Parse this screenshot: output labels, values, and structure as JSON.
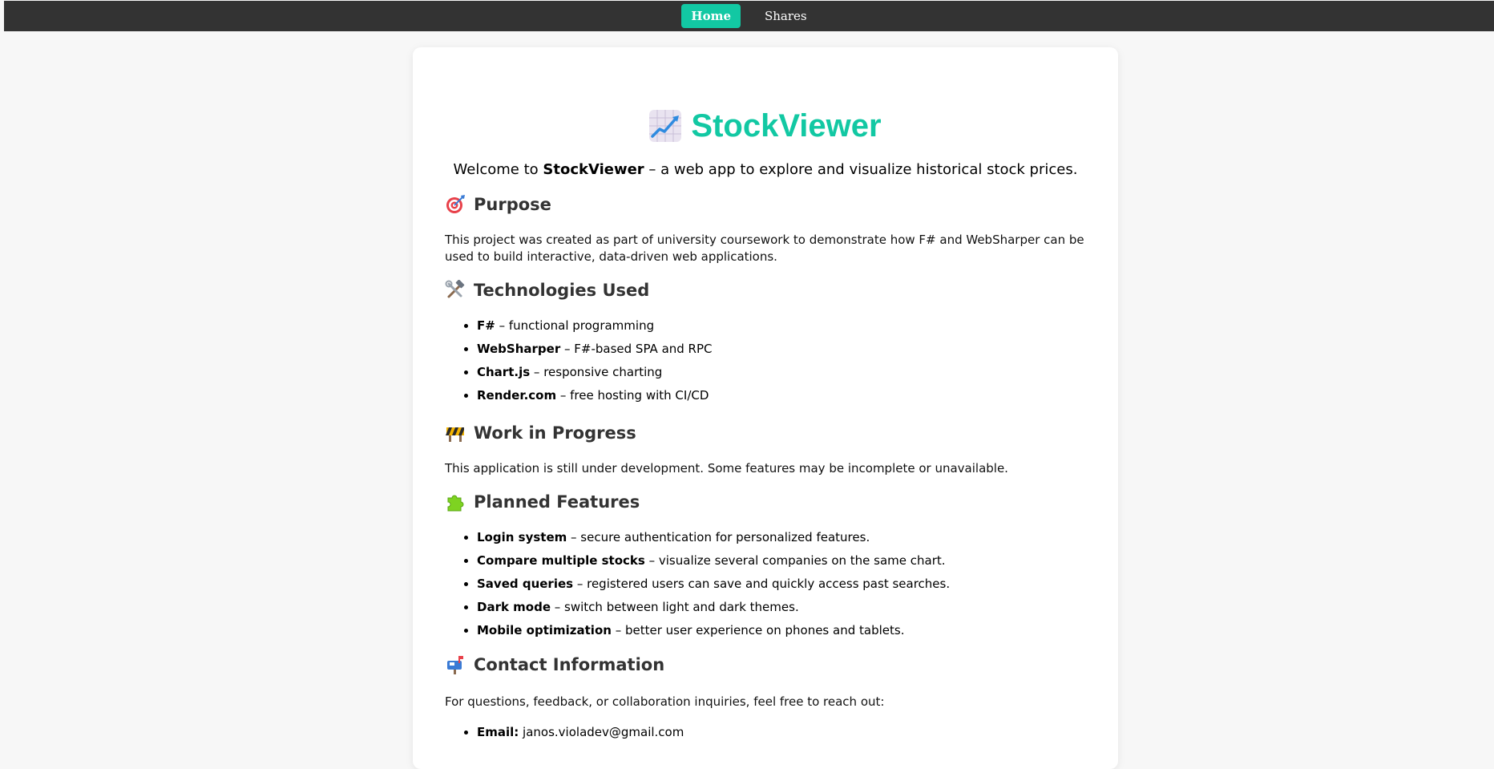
{
  "nav": {
    "items": [
      {
        "label": "Home",
        "active": true
      },
      {
        "label": "Shares",
        "active": false
      }
    ]
  },
  "header": {
    "icon": "chart-increasing-icon",
    "title": "StockViewer",
    "welcome_pre": "Welcome to ",
    "welcome_bold": "StockViewer",
    "welcome_post": " – a web app to explore and visualize historical stock prices."
  },
  "sections": {
    "purpose": {
      "icon": "direct-hit-icon",
      "title": "Purpose",
      "text": "This project was created as part of university coursework to demonstrate how F# and WebSharper can be used to build interactive, data-driven web applications."
    },
    "tech": {
      "icon": "hammer-wrench-icon",
      "title": "Technologies Used",
      "items": [
        {
          "name": "F#",
          "desc": " – functional programming"
        },
        {
          "name": "WebSharper",
          "desc": " – F#-based SPA and RPC"
        },
        {
          "name": "Chart.js",
          "desc": " – responsive charting"
        },
        {
          "name": "Render.com",
          "desc": " – free hosting with CI/CD"
        }
      ]
    },
    "wip": {
      "icon": "construction-icon",
      "title": "Work in Progress",
      "text": "This application is still under development. Some features may be incomplete or unavailable."
    },
    "planned": {
      "icon": "puzzle-piece-icon",
      "title": "Planned Features",
      "items": [
        {
          "name": "Login system",
          "desc": " – secure authentication for personalized features."
        },
        {
          "name": "Compare multiple stocks",
          "desc": " – visualize several companies on the same chart."
        },
        {
          "name": "Saved queries",
          "desc": " – registered users can save and quickly access past searches."
        },
        {
          "name": "Dark mode",
          "desc": " – switch between light and dark themes."
        },
        {
          "name": "Mobile optimization",
          "desc": " – better user experience on phones and tablets."
        }
      ]
    },
    "contact": {
      "icon": "mailbox-icon",
      "title": "Contact Information",
      "text": "For questions, feedback, or collaboration inquiries, feel free to reach out:",
      "items": [
        {
          "name": "Email:",
          "desc": " janos.violadev@gmail.com"
        }
      ]
    }
  },
  "colors": {
    "accent": "#12c8a3",
    "navbar": "#333333",
    "background": "#f7f7f7",
    "card": "#ffffff",
    "heading": "#333333"
  }
}
